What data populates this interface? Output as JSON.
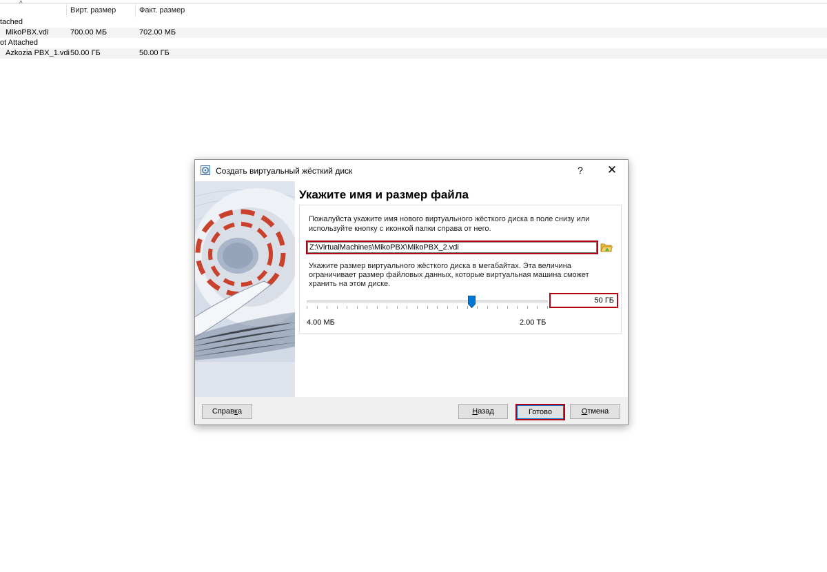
{
  "list": {
    "columns": {
      "virtual_size": "Вирт. размер",
      "actual_size": "Факт. размер"
    },
    "groups": [
      {
        "label": "tached"
      },
      {
        "label": "ot Attached"
      }
    ],
    "rows": [
      {
        "name": "MikoPBX.vdi",
        "virtual": "700.00 МБ",
        "actual": "702.00 МБ"
      },
      {
        "name": "Azkozia PBX_1.vdi",
        "virtual": "50.00 ГБ",
        "actual": "50.00 ГБ"
      }
    ]
  },
  "dialog": {
    "title": "Создать виртуальный жёсткий диск",
    "help_glyph": "?",
    "close_glyph": "✕",
    "heading": "Укажите имя и размер файла",
    "description_name": "Пожалуйста укажите имя нового виртуального жёсткого диска в поле снизу или используйте кнопку с иконкой папки справа от него.",
    "file_path": "Z:\\VirtualMachines\\MikoPBX\\MikoPBX_2.vdi",
    "description_size": "Укажите размер виртуального жёсткого диска в мегабайтах. Эта величина ограничивает размер файловых данных, которые виртуальная машина сможет хранить на этом диске.",
    "size_value": "50 ГБ",
    "slider_level": 0.69,
    "slider_min": "4.00 МБ",
    "slider_max": "2.00 ТБ",
    "buttons": {
      "help": {
        "text": "Справ",
        "mnemonic": "к",
        "tail": "а"
      },
      "back": {
        "mnemonic": "Н",
        "tail": "азад"
      },
      "done": {
        "text": "Готово"
      },
      "cancel": {
        "mnemonic": "О",
        "tail": "тмена"
      }
    }
  },
  "icons": {
    "dialog": "virtual-disk-icon",
    "folder": "folder-open-icon",
    "sort": "sort-up-icon",
    "slider": "slider-thumb"
  },
  "colors": {
    "highlight": "#b30015",
    "slider_thumb": "#0078d7",
    "side_panel": "#d6dde8"
  }
}
